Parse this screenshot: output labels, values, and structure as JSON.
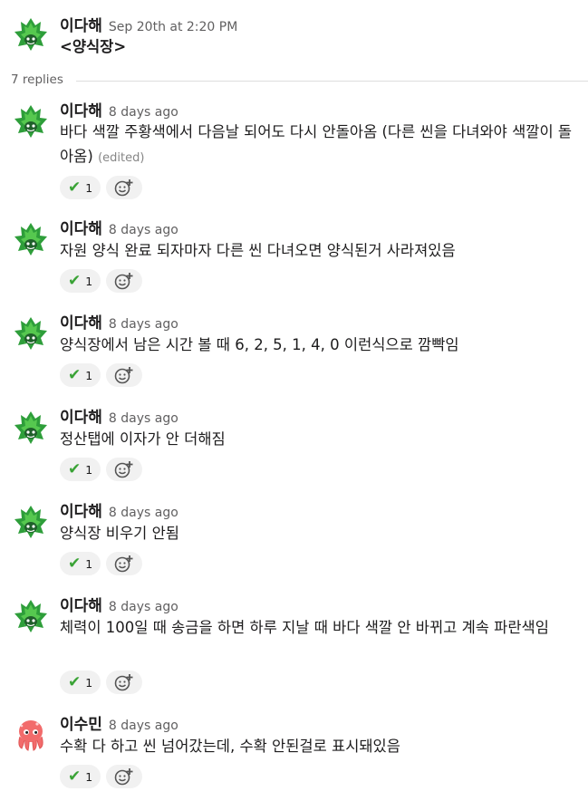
{
  "root": {
    "author": "이다해",
    "time": "Sep 20th at 2:20 PM",
    "text": "<양식장>"
  },
  "replies_label": "7 replies",
  "icons": {
    "check": "✔",
    "add_reaction": "add-reaction-icon"
  },
  "replies": [
    {
      "author": "이다해",
      "time": "8 days ago",
      "text": "바다 색깔 주황색에서 다음날 되어도 다시 안돌아옴 (다른 씬을 다녀와야 색깔이 돌아옴)",
      "edited": "(edited)",
      "reaction_count": "1"
    },
    {
      "author": "이다해",
      "time": "8 days ago",
      "text": "자원 양식 완료 되자마자 다른 씬 다녀오면 양식된거 사라져있음",
      "reaction_count": "1"
    },
    {
      "author": "이다해",
      "time": "8 days ago",
      "text": "양식장에서 남은 시간 볼 때 6, 2, 5, 1, 4, 0 이런식으로 깜빡임",
      "reaction_count": "1"
    },
    {
      "author": "이다해",
      "time": "8 days ago",
      "text": "정산탭에 이자가 안 더해짐",
      "reaction_count": "1"
    },
    {
      "author": "이다해",
      "time": "8 days ago",
      "text": "양식장 비우기 안됨",
      "reaction_count": "1"
    },
    {
      "author": "이다해",
      "time": "8 days ago",
      "text": "체력이 100일 때 송금을 하면 하루 지날 때 바다 색깔 안 바뀌고 계속 파란색임",
      "reaction_count": "1"
    },
    {
      "author": "이수민",
      "time": "8 days ago",
      "text": "수확 다 하고 씬 넘어갔는데, 수확 안된걸로 표시돼있음",
      "reaction_count": "1"
    }
  ]
}
